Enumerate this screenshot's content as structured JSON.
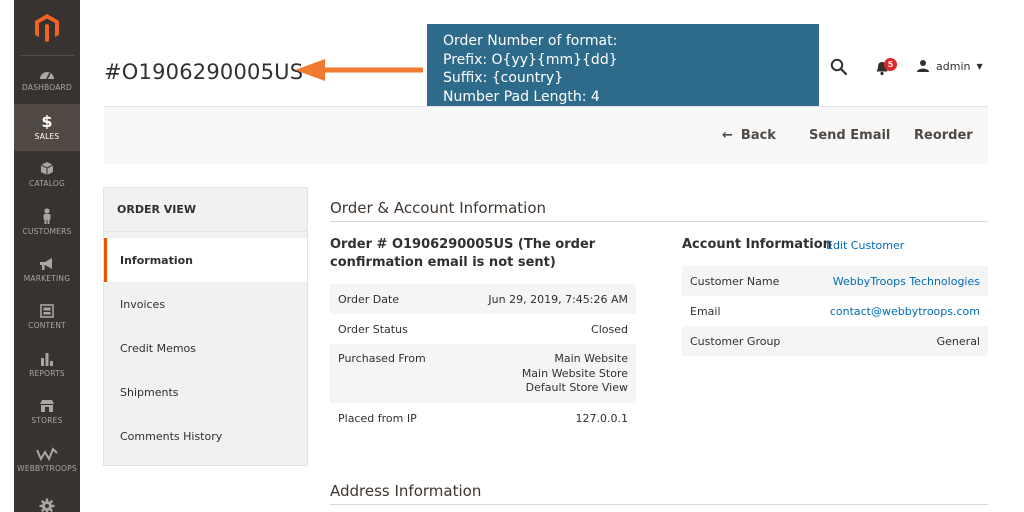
{
  "sidebar": {
    "items": [
      {
        "label": "DASHBOARD",
        "icon": "dashboard-icon"
      },
      {
        "label": "SALES",
        "icon": "dollar-icon"
      },
      {
        "label": "CATALOG",
        "icon": "cube-icon"
      },
      {
        "label": "CUSTOMERS",
        "icon": "person-icon"
      },
      {
        "label": "MARKETING",
        "icon": "megaphone-icon"
      },
      {
        "label": "CONTENT",
        "icon": "layout-icon"
      },
      {
        "label": "REPORTS",
        "icon": "bar-chart-icon"
      },
      {
        "label": "STORES",
        "icon": "store-icon"
      },
      {
        "label": "WEBBYTROOPS",
        "icon": "webbytroops-icon"
      },
      {
        "label": "",
        "icon": "gear-icon"
      }
    ]
  },
  "header": {
    "title": "#O1906290005US",
    "admin_label": "admin",
    "notification_count": "5"
  },
  "callout": {
    "line1": "Order Number of format:",
    "line2": "Prefix: O{yy}{mm}{dd}",
    "line3": "Suffix: {country}",
    "line4": "Number Pad Length: 4"
  },
  "actions": {
    "back": "Back",
    "send_email": "Send Email",
    "reorder": "Reorder"
  },
  "tabs": {
    "title": "ORDER VIEW",
    "items": [
      "Information",
      "Invoices",
      "Credit Memos",
      "Shipments",
      "Comments History"
    ]
  },
  "order_account": {
    "section_title": "Order & Account Information",
    "order_heading": "Order # O1906290005US (The order confirmation email is not sent)",
    "rows": [
      {
        "label": "Order Date",
        "value": [
          "Jun 29, 2019, 7:45:26 AM"
        ]
      },
      {
        "label": "Order Status",
        "value": [
          "Closed"
        ]
      },
      {
        "label": "Purchased From",
        "value": [
          "Main Website",
          "Main Website Store",
          "Default Store View"
        ]
      },
      {
        "label": "Placed from IP",
        "value": [
          "127.0.0.1"
        ]
      }
    ]
  },
  "account": {
    "title": "Account Information",
    "edit_link": "Edit Customer",
    "rows": [
      {
        "label": "Customer Name",
        "value": "WebbyTroops Technologies"
      },
      {
        "label": "Email",
        "value": "contact@webbytroops.com"
      },
      {
        "label": "Customer Group",
        "value": "General"
      }
    ]
  },
  "address": {
    "section_title": "Address Information"
  },
  "colors": {
    "sidebar_bg": "#373330",
    "sidebar_active": "#514943",
    "accent_orange": "#eb5202",
    "arrow_orange": "#f07a30",
    "callout_bg": "#2e6b8a",
    "link": "#006bb4"
  }
}
